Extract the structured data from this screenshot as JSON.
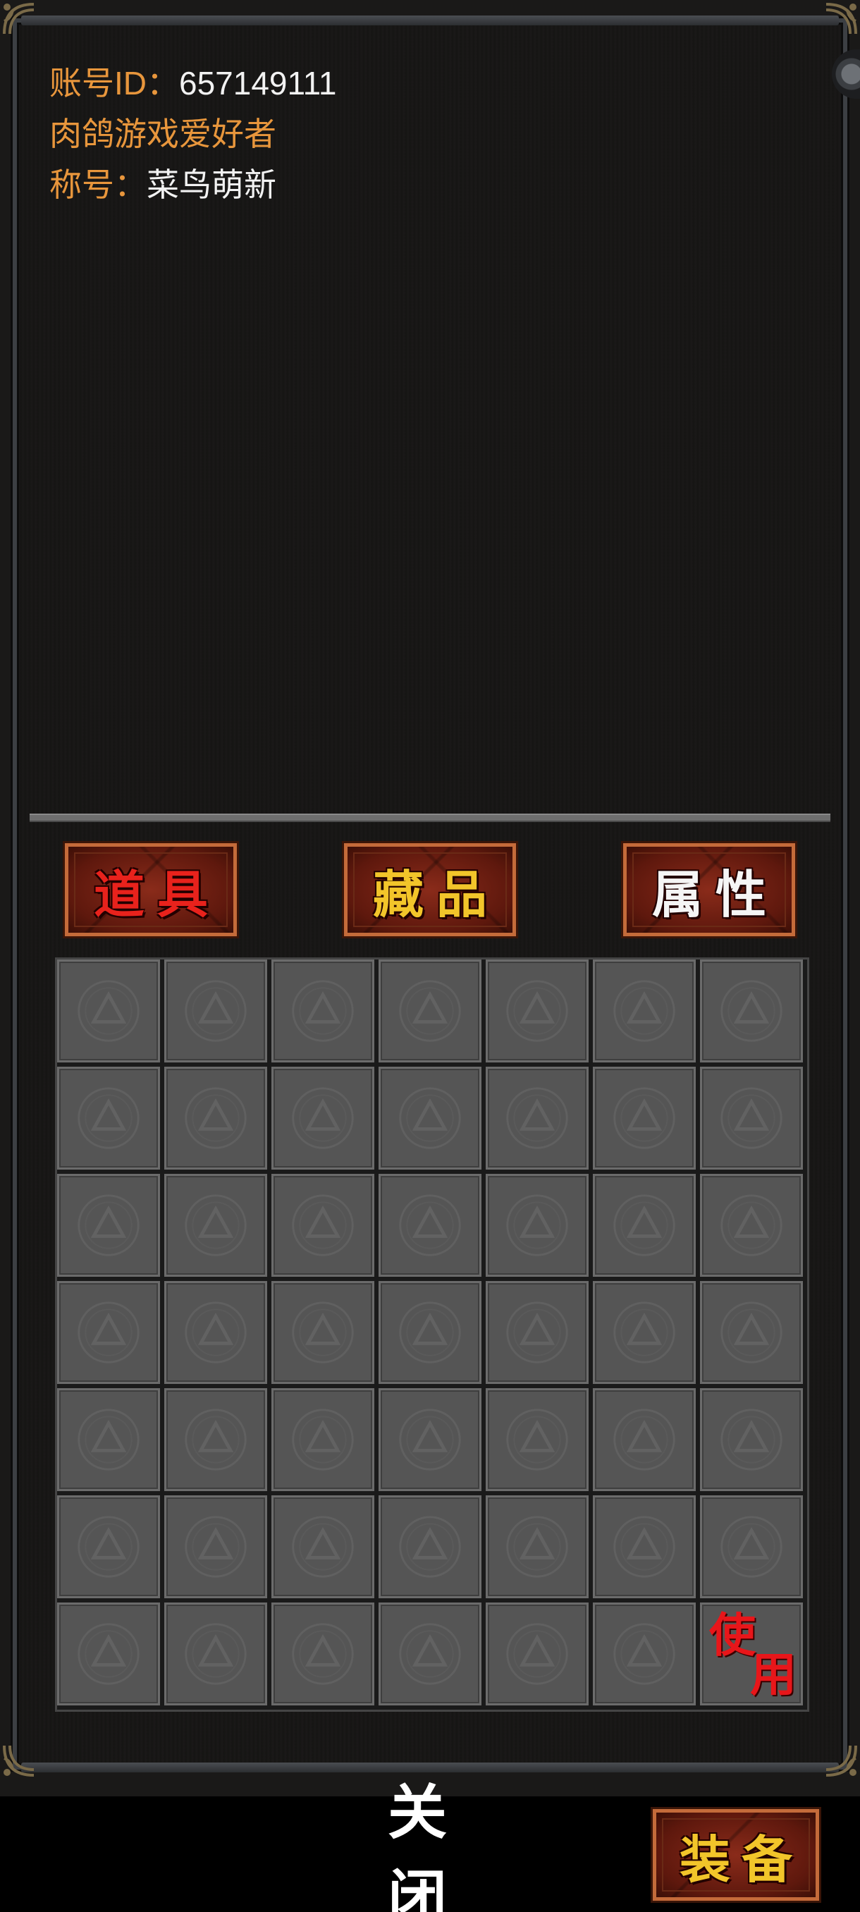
{
  "profile": {
    "account_label": "账号ID：",
    "account_id": "657149111",
    "nickname": "肉鸽游戏爱好者",
    "title_label": "称号：",
    "title_value": "菜鸟萌新"
  },
  "tabs": [
    {
      "label": "道具",
      "color": "#e8221c"
    },
    {
      "label": "藏品",
      "color": "#f2c52a"
    },
    {
      "label": "属性",
      "color": "#f5f5f5"
    }
  ],
  "inventory": {
    "rows": 7,
    "columns": 7,
    "empty_slot_icon": "triangle-emblem-icon",
    "use_label_char1": "使",
    "use_label_char2": "用"
  },
  "footer": {
    "close_label": "关闭",
    "equip_label": "装备"
  },
  "colors": {
    "label_orange": "#e8963c",
    "button_red": "#8a2b1a",
    "button_border": "#c46b3a",
    "slot_gray": "#555555"
  }
}
